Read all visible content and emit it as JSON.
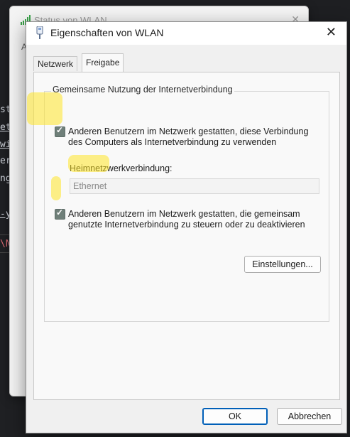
{
  "background_window": {
    "title": "Status von WLAN",
    "tab_label": "A",
    "code_lines": [
      "st",
      "et",
      "wi",
      "er",
      "ng",
      "-y",
      "\\N"
    ]
  },
  "dialog": {
    "title": "Eigenschaften von WLAN",
    "close_symbol": "✕",
    "tabs": [
      {
        "label": "Netzwerk",
        "active": false
      },
      {
        "label": "Freigabe",
        "active": true
      }
    ],
    "group_label": "Gemeinsame Nutzung der Internetverbindung",
    "checkbox1": {
      "checked": true,
      "line1": "Anderen Benutzern im Netzwerk gestatten, diese Verbindung",
      "line2": "des Computers als Internetverbindung zu verwenden"
    },
    "home_connection": {
      "label": "Heimnetzwerkverbindung:",
      "value": "Ethernet"
    },
    "checkbox2": {
      "checked": true,
      "line1": "Anderen Benutzern im Netzwerk gestatten, die gemeinsam",
      "line2": "genutzte Internetverbindung zu steuern oder zu deaktivieren"
    },
    "settings_button": "Einstellungen...",
    "ok_button": "OK",
    "cancel_button": "Abbrechen"
  },
  "colors": {
    "accent": "#005fb8",
    "highlight": "#ffe628",
    "checkbox": "#6f7f79"
  },
  "icons": [
    "wifi-signal-icon",
    "network-adapter-icon",
    "close-icon",
    "checkbox-checked-icon"
  ]
}
